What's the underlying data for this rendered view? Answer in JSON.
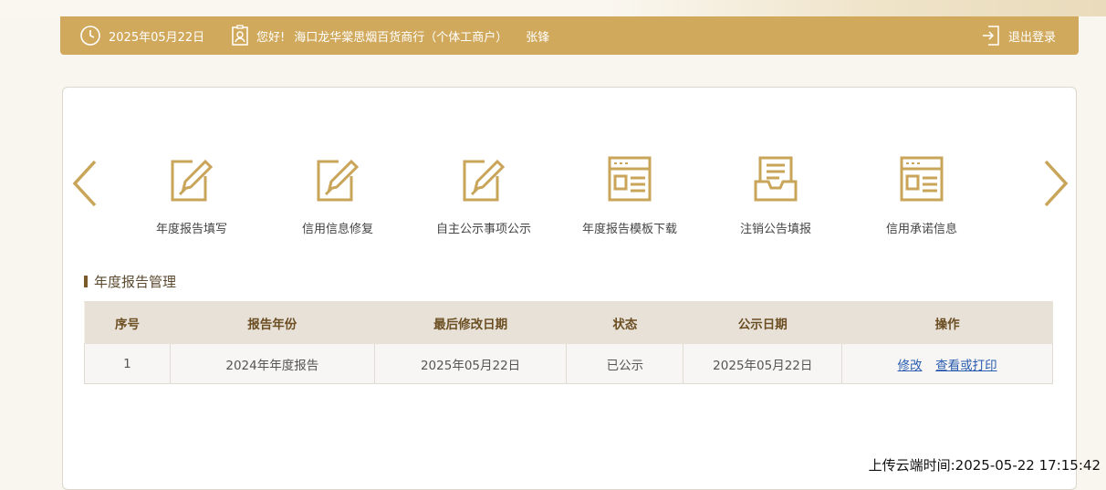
{
  "header": {
    "date": "2025年05月22日",
    "greeting": "您好!",
    "company": "海口龙华棠思烟百货商行（个体工商户）",
    "user": "张锋",
    "logout_label": "退出登录"
  },
  "tiles": [
    {
      "label": "年度报告填写",
      "icon": "edit-icon"
    },
    {
      "label": "信用信息修复",
      "icon": "edit-icon"
    },
    {
      "label": "自主公示事项公示",
      "icon": "edit-icon"
    },
    {
      "label": "年度报告模板下载",
      "icon": "template-icon"
    },
    {
      "label": "注销公告填报",
      "icon": "inbox-icon"
    },
    {
      "label": "信用承诺信息",
      "icon": "template-icon"
    }
  ],
  "section": {
    "title": "年度报告管理"
  },
  "table": {
    "headers": [
      "序号",
      "报告年份",
      "最后修改日期",
      "状态",
      "公示日期",
      "操作"
    ],
    "rows": [
      {
        "index": "1",
        "report": "2024年年度报告",
        "modified": "2025年05月22日",
        "status": "已公示",
        "publish": "2025年05月22日",
        "edit": "修改",
        "view": "查看或打印"
      }
    ]
  },
  "upload_time": "上传云端时间:2025-05-22 17:15:42",
  "colors": {
    "accent": "#d1a95c",
    "icon": "#c9a55a",
    "link": "#2a5db0",
    "table_header": "#e8e1d8"
  }
}
